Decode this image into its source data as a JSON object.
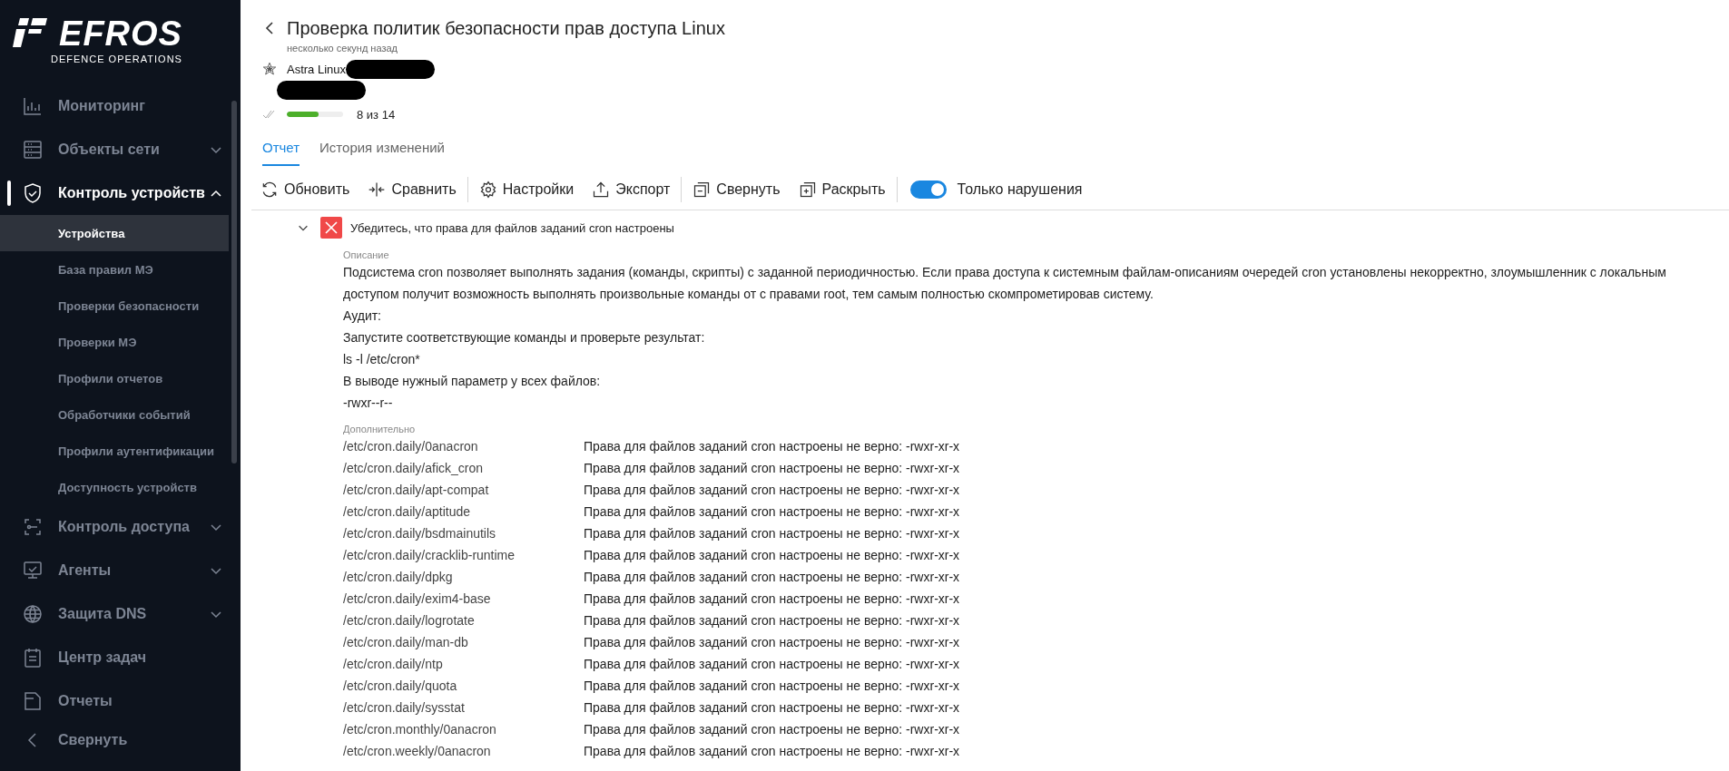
{
  "sidebar": {
    "logo": {
      "name": "EFROS",
      "tagline": "DEFENCE OPERATIONS"
    },
    "items": [
      {
        "label": "Мониторинг",
        "kind": "chart",
        "selected": false
      },
      {
        "label": "Объекты сети",
        "kind": "server",
        "selected": false,
        "expanded": false
      },
      {
        "label": "Контроль устройств",
        "kind": "shield",
        "selected": true,
        "expanded": true,
        "children": [
          {
            "label": "Устройства",
            "selected": true
          },
          {
            "label": "База правил МЭ",
            "selected": false
          },
          {
            "label": "Проверки безопасности",
            "selected": false
          },
          {
            "label": "Проверки МЭ",
            "selected": false
          },
          {
            "label": "Профили отчетов",
            "selected": false
          },
          {
            "label": "Обработчики событий",
            "selected": false
          },
          {
            "label": "Профили аутентификации",
            "selected": false
          },
          {
            "label": "Доступность устройств",
            "selected": false
          }
        ]
      },
      {
        "label": "Контроль доступа",
        "kind": "scan",
        "selected": false,
        "expanded": false
      },
      {
        "label": "Агенты",
        "kind": "monitor",
        "selected": false,
        "expanded": false
      },
      {
        "label": "Защита DNS",
        "kind": "globe",
        "selected": false,
        "expanded": false
      },
      {
        "label": "Центр задач",
        "kind": "clipboard",
        "selected": false
      },
      {
        "label": "Отчеты",
        "kind": "report",
        "selected": false
      }
    ],
    "collapse_label": "Свернуть"
  },
  "header": {
    "title": "Проверка политик безопасности прав доступа Linux",
    "subtitle": "несколько секунд назад",
    "device": "Astra Linux",
    "progress": {
      "level": 0.57,
      "label": "8 из 14"
    }
  },
  "tabs": [
    {
      "label": "Отчет",
      "selected": true
    },
    {
      "label": "История изменений",
      "selected": false
    }
  ],
  "toolbar": {
    "groups": [
      [
        {
          "label": "Обновить",
          "kind": "refresh"
        },
        {
          "label": "Сравнить",
          "kind": "compare"
        }
      ],
      [
        {
          "label": "Настройки",
          "kind": "settings"
        },
        {
          "label": "Экспорт",
          "kind": "export"
        }
      ],
      [
        {
          "label": "Свернуть",
          "kind": "collapse"
        },
        {
          "label": "Раскрыть",
          "kind": "expand"
        }
      ]
    ],
    "toggle": {
      "label": "Только нарушения",
      "on": true
    }
  },
  "check": {
    "title": "Убедитесь, что права для файлов заданий cron настроены",
    "passed": false,
    "expanded": true,
    "description_label": "Описание",
    "description": [
      "Подсистема cron позволяет выполнять задания (команды, скрипты) с заданной периодичностью. Если права доступа к системным файлам-описаниям очередей cron установлены некорректно, злоумышленник с локальным доступом получит возможность выполнять произвольные команды от с правами root, тем самым полностью скомпрометировав систему.",
      "Аудит:",
      "Запустите соответствующие команды и проверьте результат:",
      "ls -l /etc/cron*",
      "В выводе нужный параметр у всех файлов:",
      "-rwxr--r--"
    ],
    "details_label": "Дополнительно",
    "details": [
      {
        "path": "/etc/cron.daily/0anacron",
        "message": "Права для файлов заданий cron настроены не верно: -rwxr-xr-x"
      },
      {
        "path": "/etc/cron.daily/afick_cron",
        "message": "Права для файлов заданий cron настроены не верно: -rwxr-xr-x"
      },
      {
        "path": "/etc/cron.daily/apt-compat",
        "message": "Права для файлов заданий cron настроены не верно: -rwxr-xr-x"
      },
      {
        "path": "/etc/cron.daily/aptitude",
        "message": "Права для файлов заданий cron настроены не верно: -rwxr-xr-x"
      },
      {
        "path": "/etc/cron.daily/bsdmainutils",
        "message": "Права для файлов заданий cron настроены не верно: -rwxr-xr-x"
      },
      {
        "path": "/etc/cron.daily/cracklib-runtime",
        "message": "Права для файлов заданий cron настроены не верно: -rwxr-xr-x"
      },
      {
        "path": "/etc/cron.daily/dpkg",
        "message": "Права для файлов заданий cron настроены не верно: -rwxr-xr-x"
      },
      {
        "path": "/etc/cron.daily/exim4-base",
        "message": "Права для файлов заданий cron настроены не верно: -rwxr-xr-x"
      },
      {
        "path": "/etc/cron.daily/logrotate",
        "message": "Права для файлов заданий cron настроены не верно: -rwxr-xr-x"
      },
      {
        "path": "/etc/cron.daily/man-db",
        "message": "Права для файлов заданий cron настроены не верно: -rwxr-xr-x"
      },
      {
        "path": "/etc/cron.daily/ntp",
        "message": "Права для файлов заданий cron настроены не верно: -rwxr-xr-x"
      },
      {
        "path": "/etc/cron.daily/quota",
        "message": "Права для файлов заданий cron настроены не верно: -rwxr-xr-x"
      },
      {
        "path": "/etc/cron.daily/sysstat",
        "message": "Права для файлов заданий cron настроены не верно: -rwxr-xr-x"
      },
      {
        "path": "/etc/cron.monthly/0anacron",
        "message": "Права для файлов заданий cron настроены не верно: -rwxr-xr-x"
      },
      {
        "path": "/etc/cron.weekly/0anacron",
        "message": "Права для файлов заданий cron настроены не верно: -rwxr-xr-x"
      }
    ]
  }
}
